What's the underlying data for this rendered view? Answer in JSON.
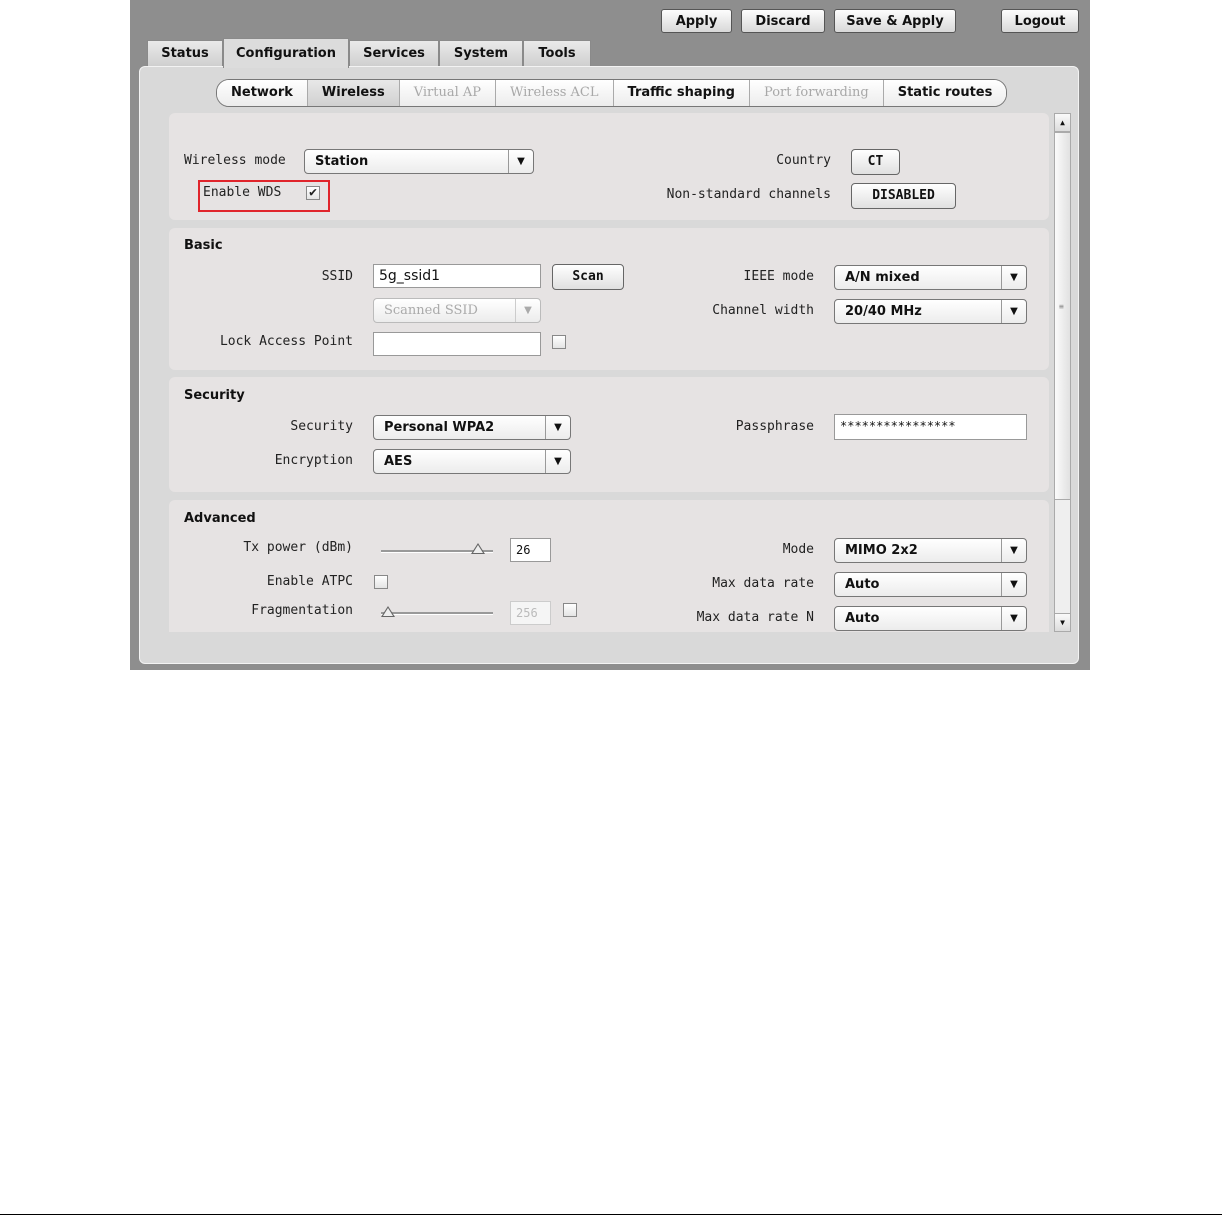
{
  "toolbar": {
    "apply": "Apply",
    "discard": "Discard",
    "save_apply": "Save & Apply",
    "logout": "Logout"
  },
  "main_tabs": [
    "Status",
    "Configuration",
    "Services",
    "System",
    "Tools"
  ],
  "active_main_tab": "Configuration",
  "sub_tabs": [
    "Network",
    "Wireless",
    "Virtual AP",
    "Wireless ACL",
    "Traffic shaping",
    "Port forwarding",
    "Static routes"
  ],
  "disabled_sub_tabs": [
    "Virtual AP",
    "Wireless ACL",
    "Port forwarding"
  ],
  "active_sub_tab": "Wireless",
  "general": {
    "wireless_mode_label": "Wireless mode",
    "wireless_mode_value": "Station",
    "enable_wds_label": "Enable WDS",
    "enable_wds_checked": true,
    "country_label": "Country",
    "country_value": "CT",
    "nonstd_label": "Non-standard channels",
    "nonstd_value": "DISABLED"
  },
  "basic": {
    "title": "Basic",
    "ssid_label": "SSID",
    "ssid_value": "5g_ssid1",
    "scan_label": "Scan",
    "scanned_ssid_value": "Scanned SSID",
    "lock_ap_label": "Lock Access Point",
    "lock_ap_value": "",
    "lock_ap_checked": false,
    "ieee_label": "IEEE mode",
    "ieee_value": "A/N mixed",
    "chwidth_label": "Channel width",
    "chwidth_value": "20/40 MHz"
  },
  "security": {
    "title": "Security",
    "security_label": "Security",
    "security_value": "Personal WPA2",
    "encryption_label": "Encryption",
    "encryption_value": "AES",
    "passphrase_label": "Passphrase",
    "passphrase_value": "****************"
  },
  "advanced": {
    "title": "Advanced",
    "txpower_label": "Tx power (dBm)",
    "txpower_value": "26",
    "txpower_level": 1.0,
    "atpc_label": "Enable ATPC",
    "atpc_checked": false,
    "frag_label": "Fragmentation",
    "frag_value": "256",
    "frag_level": 0.0,
    "frag_checked": false,
    "mode_label": "Mode",
    "mode_value": "MIMO 2x2",
    "maxrate_label": "Max data rate",
    "maxrate_value": "Auto",
    "maxrate_n_label": "Max data rate N",
    "maxrate_n_value": "Auto"
  },
  "colors": {
    "highlight": "#e0242b",
    "frame": "#8e8e8e",
    "panel": "#d9d9d9",
    "section": "#e6e3e3"
  },
  "icons": {
    "dropdown": "chevron-down-icon",
    "check": "checkmark-icon",
    "scroll_up": "scroll-up-icon",
    "scroll_down": "scroll-down-icon"
  }
}
